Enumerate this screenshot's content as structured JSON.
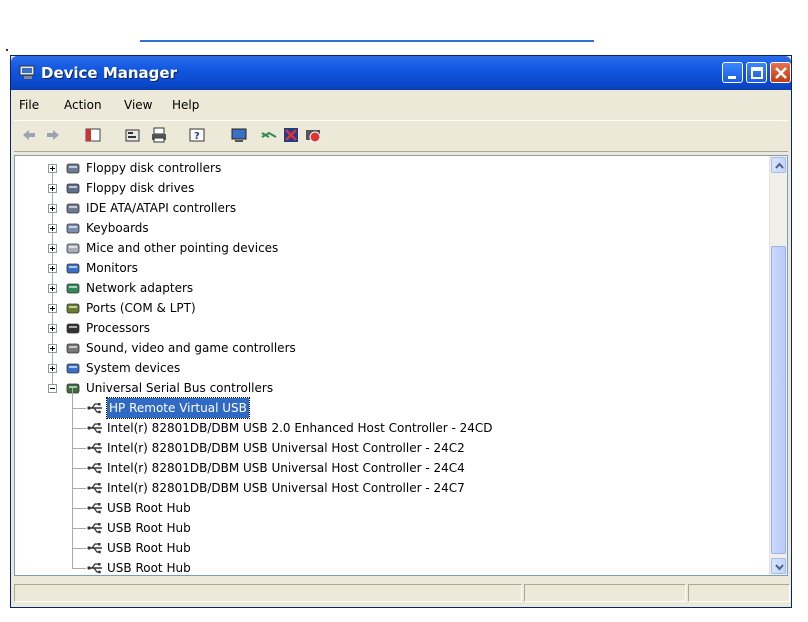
{
  "window": {
    "title": "Device Manager"
  },
  "menu": {
    "items": [
      "File",
      "Action",
      "View",
      "Help"
    ]
  },
  "toolbar": {
    "icons": [
      "back-arrow-icon",
      "forward-arrow-icon",
      "show-hide-console-tree-icon",
      "properties-icon",
      "print-icon",
      "help-icon",
      "scan-hardware-icon",
      "update-driver-icon",
      "uninstall-icon",
      "disable-icon"
    ]
  },
  "tree": {
    "categories": [
      {
        "label": "Floppy disk controllers",
        "icon": "floppy-controller-icon"
      },
      {
        "label": "Floppy disk drives",
        "icon": "floppy-drive-icon"
      },
      {
        "label": "IDE ATA/ATAPI controllers",
        "icon": "ide-controller-icon"
      },
      {
        "label": "Keyboards",
        "icon": "keyboard-icon"
      },
      {
        "label": "Mice and other pointing devices",
        "icon": "mouse-icon"
      },
      {
        "label": "Monitors",
        "icon": "monitor-icon"
      },
      {
        "label": "Network adapters",
        "icon": "network-adapter-icon"
      },
      {
        "label": "Ports (COM & LPT)",
        "icon": "ports-icon"
      },
      {
        "label": "Processors",
        "icon": "processor-icon"
      },
      {
        "label": "Sound, video and game controllers",
        "icon": "sound-icon"
      },
      {
        "label": "System devices",
        "icon": "system-devices-icon"
      },
      {
        "label": "Universal Serial Bus controllers",
        "icon": "usb-icon"
      }
    ],
    "usb_children": [
      {
        "label": "HP Remote Virtual USB",
        "selected": true
      },
      {
        "label": "Intel(r) 82801DB/DBM USB 2.0 Enhanced Host Controller - 24CD"
      },
      {
        "label": "Intel(r) 82801DB/DBM USB Universal Host Controller - 24C2"
      },
      {
        "label": "Intel(r) 82801DB/DBM USB Universal Host Controller - 24C4"
      },
      {
        "label": "Intel(r) 82801DB/DBM USB Universal Host Controller - 24C7"
      },
      {
        "label": "USB Root Hub"
      },
      {
        "label": "USB Root Hub"
      },
      {
        "label": "USB Root Hub"
      },
      {
        "label": "USB Root Hub"
      }
    ]
  },
  "colors": {
    "titlebar": "#0a48c9",
    "selection": "#316ac5",
    "window_bg": "#ece9d8"
  }
}
